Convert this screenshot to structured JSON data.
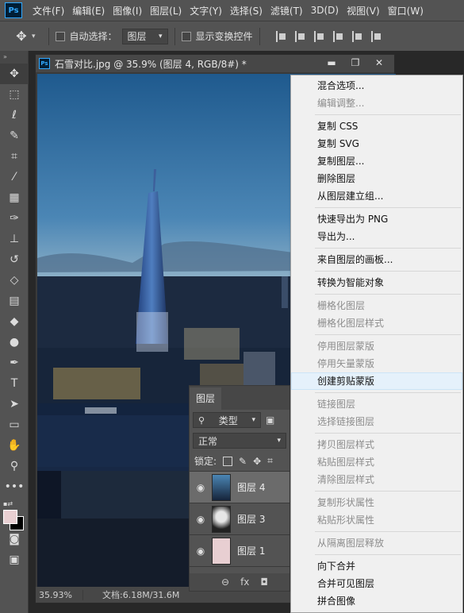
{
  "app": {
    "logo": "Ps"
  },
  "menubar": {
    "items": [
      "文件(F)",
      "编辑(E)",
      "图像(I)",
      "图层(L)",
      "文字(Y)",
      "选择(S)",
      "滤镜(T)",
      "3D(D)",
      "视图(V)",
      "窗口(W)"
    ]
  },
  "options": {
    "auto_select_label": "自动选择：",
    "auto_select_value": "图层",
    "show_transform_label": "显示变换控件"
  },
  "document": {
    "title": "石雪对比.jpg @ 35.9% (图层 4, RGB/8#) *",
    "zoom": "35.93%",
    "doc_size": "文档:6.18M/31.6M",
    "minimize": "▬",
    "restore": "❐",
    "close": "✕"
  },
  "layers_panel": {
    "tab": "图层",
    "kind_filter": "类型",
    "blend_mode": "正常",
    "lock_label": "锁定:",
    "layers": [
      {
        "name": "图层 4",
        "selected": true
      },
      {
        "name": "图层 3",
        "selected": false
      },
      {
        "name": "图层 1",
        "selected": false
      }
    ],
    "footer": [
      "⊖",
      "fx",
      "◘"
    ]
  },
  "context_menu": {
    "groups": [
      [
        {
          "label": "混合选项...",
          "disabled": false
        },
        {
          "label": "编辑调整...",
          "disabled": true
        }
      ],
      [
        {
          "label": "复制 CSS",
          "disabled": false
        },
        {
          "label": "复制 SVG",
          "disabled": false
        },
        {
          "label": "复制图层...",
          "disabled": false
        },
        {
          "label": "删除图层",
          "disabled": false
        },
        {
          "label": "从图层建立组...",
          "disabled": false
        }
      ],
      [
        {
          "label": "快速导出为 PNG",
          "disabled": false
        },
        {
          "label": "导出为...",
          "disabled": false
        }
      ],
      [
        {
          "label": "来自图层的画板...",
          "disabled": false
        }
      ],
      [
        {
          "label": "转换为智能对象",
          "disabled": false
        }
      ],
      [
        {
          "label": "栅格化图层",
          "disabled": true
        },
        {
          "label": "栅格化图层样式",
          "disabled": true
        }
      ],
      [
        {
          "label": "停用图层蒙版",
          "disabled": true
        },
        {
          "label": "停用矢量蒙版",
          "disabled": true
        },
        {
          "label": "创建剪贴蒙版",
          "disabled": false,
          "hover": true
        }
      ],
      [
        {
          "label": "链接图层",
          "disabled": true
        },
        {
          "label": "选择链接图层",
          "disabled": true
        }
      ],
      [
        {
          "label": "拷贝图层样式",
          "disabled": true
        },
        {
          "label": "粘贴图层样式",
          "disabled": true
        },
        {
          "label": "清除图层样式",
          "disabled": true
        }
      ],
      [
        {
          "label": "复制形状属性",
          "disabled": true
        },
        {
          "label": "粘贴形状属性",
          "disabled": true
        }
      ],
      [
        {
          "label": "从隔离图层释放",
          "disabled": true
        }
      ],
      [
        {
          "label": "向下合并",
          "disabled": false
        },
        {
          "label": "合并可见图层",
          "disabled": false
        },
        {
          "label": "拼合图像",
          "disabled": false
        }
      ]
    ]
  },
  "tools": [
    "move-tool-icon",
    "marquee-tool-icon",
    "lasso-tool-icon",
    "quick-select-tool-icon",
    "crop-tool-icon",
    "eyedropper-tool-icon",
    "healing-brush-tool-icon",
    "brush-tool-icon",
    "clone-stamp-tool-icon",
    "history-brush-tool-icon",
    "eraser-tool-icon",
    "gradient-tool-icon",
    "blur-tool-icon",
    "dodge-tool-icon",
    "pen-tool-icon",
    "type-tool-icon",
    "path-select-tool-icon",
    "shape-tool-icon",
    "hand-tool-icon",
    "zoom-tool-icon",
    "more-tools-icon"
  ],
  "colors": {
    "foreground": "#e8cfd2",
    "background": "#000000",
    "accent": "#31a8ff"
  }
}
